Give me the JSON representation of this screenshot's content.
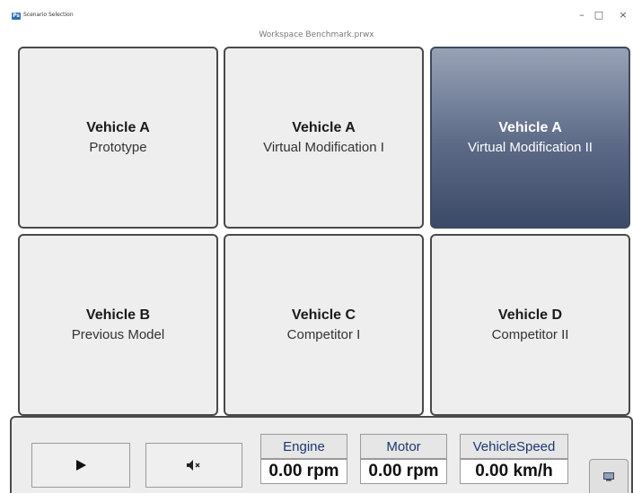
{
  "window": {
    "app_title": "Scenario Selection",
    "document_title": "Workspace Benchmark.prwx",
    "minimize_glyph": "–",
    "maximize_glyph": "□",
    "close_glyph": "×"
  },
  "tiles": [
    {
      "line1": "Vehicle A",
      "line2": "Prototype",
      "selected": false
    },
    {
      "line1": "Vehicle A",
      "line2": "Virtual Modification I",
      "selected": false
    },
    {
      "line1": "Vehicle A",
      "line2": "Virtual Modification II",
      "selected": true
    },
    {
      "line1": "Vehicle B",
      "line2": "Previous Model",
      "selected": false
    },
    {
      "line1": "Vehicle C",
      "line2": "Competitor I",
      "selected": false
    },
    {
      "line1": "Vehicle D",
      "line2": "Competitor II",
      "selected": false
    }
  ],
  "controls": {
    "play_icon": "play-icon",
    "mute_icon": "speaker-muted-icon",
    "corner_icon": "window-icon"
  },
  "gauges": [
    {
      "label": "Engine",
      "value": "0.00 rpm"
    },
    {
      "label": "Motor",
      "value": "0.00 rpm"
    },
    {
      "label": "VehicleSpeed",
      "value": "0.00 km/h"
    }
  ],
  "colors": {
    "selected_tile_top": "#98a2b6",
    "selected_tile_bottom": "#3b4a67",
    "tile_bg": "#eeeeee",
    "gauge_label_text": "#1a3870"
  }
}
